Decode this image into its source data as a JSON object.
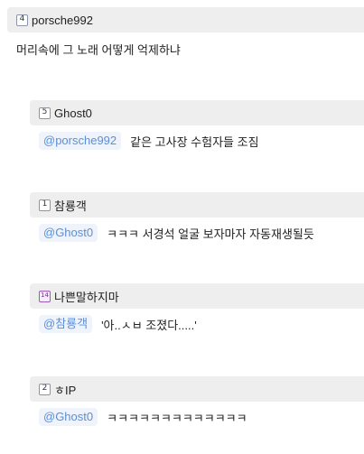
{
  "comments": [
    {
      "level": "4",
      "nick": "porsche992",
      "mention": "",
      "text": "머리속에 그 노래 어떻게 억제하냐"
    },
    {
      "level": "5",
      "nick": "Ghost0",
      "mention": "@porsche992",
      "text": "같은 고사장 수험자들 조짐"
    },
    {
      "level": "1",
      "nick": "참룡객",
      "mention": "@Ghost0",
      "text": "ㅋㅋㅋ 서경석 얼굴 보자마자 자동재생될듯"
    },
    {
      "level": "14",
      "nick": "나쁜말하지마",
      "mention": "@참룡객",
      "text": "'아..ㅅㅂ 조졌다.....'"
    },
    {
      "level": "2",
      "nick": "ㅎIP",
      "mention": "@Ghost0",
      "text": "ㅋㅋㅋㅋㅋㅋㅋㅋㅋㅋㅋㅋㅋ"
    }
  ]
}
